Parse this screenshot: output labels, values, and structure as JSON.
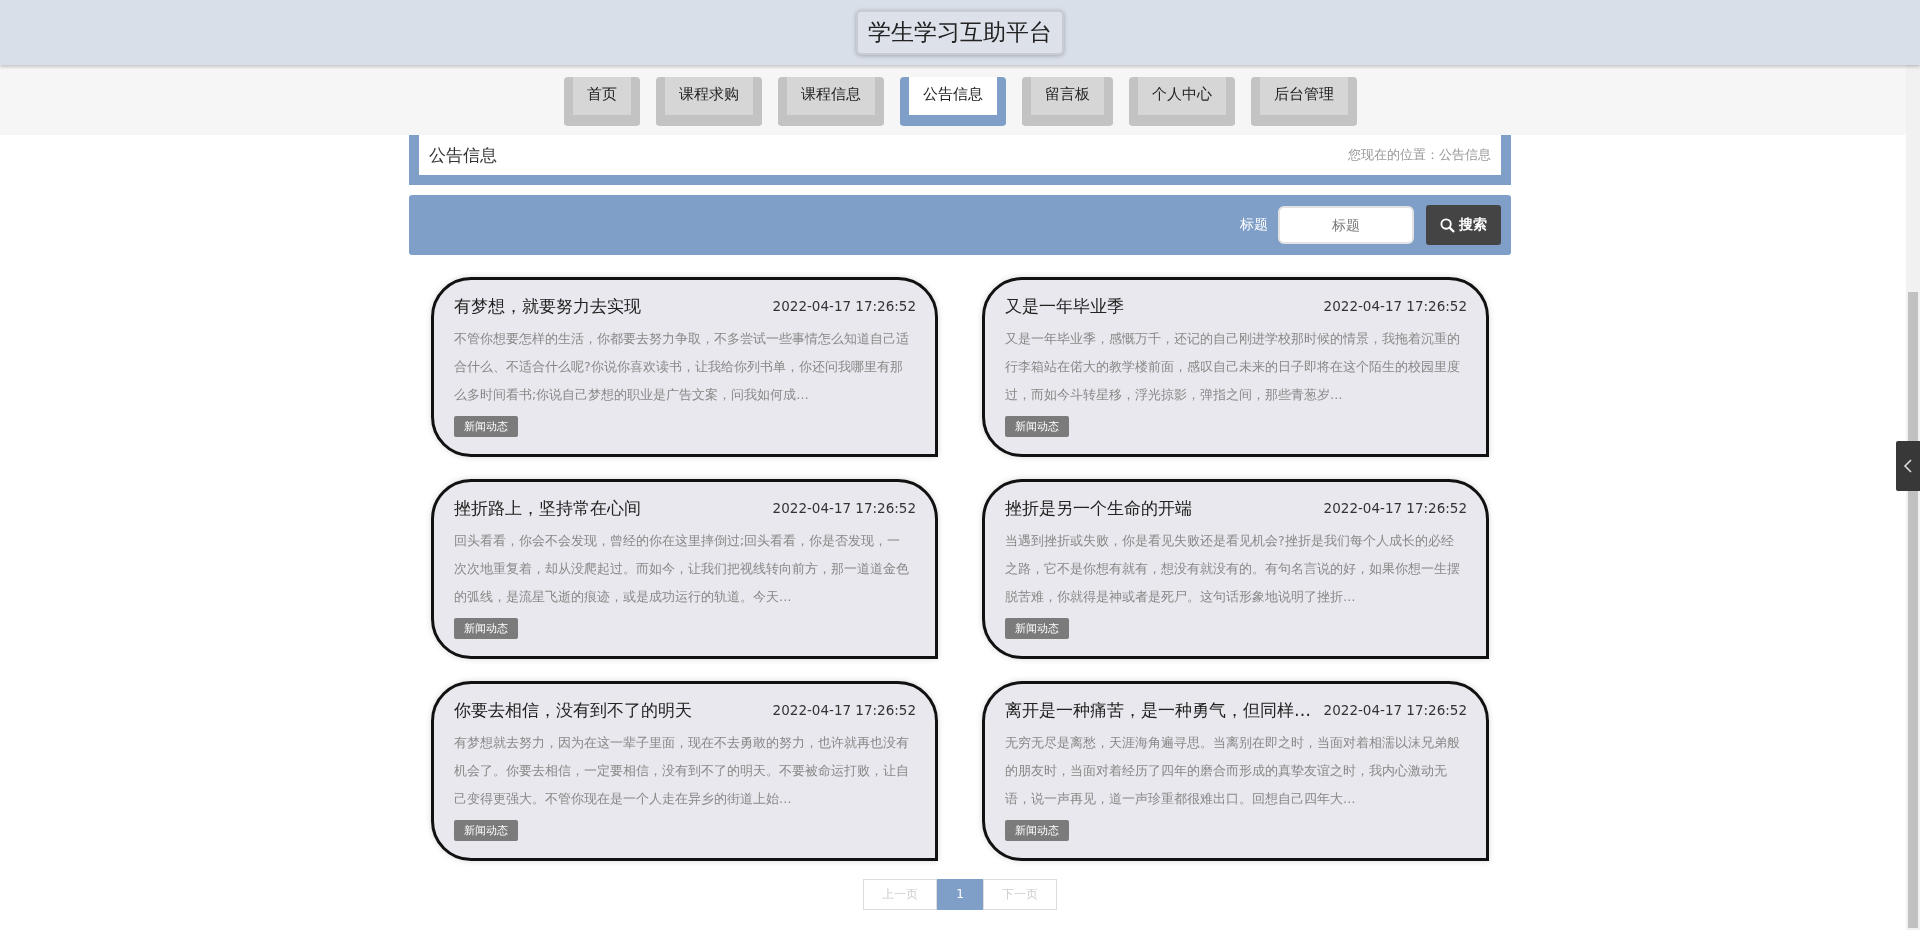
{
  "header": {
    "title": "学生学习互助平台"
  },
  "nav": [
    {
      "label": "首页",
      "selected": false
    },
    {
      "label": "课程求购",
      "selected": false
    },
    {
      "label": "课程信息",
      "selected": false
    },
    {
      "label": "公告信息",
      "selected": true
    },
    {
      "label": "留言板",
      "selected": false
    },
    {
      "label": "个人中心",
      "selected": false
    },
    {
      "label": "后台管理",
      "selected": false
    }
  ],
  "breadcrumb": {
    "heading": "公告信息",
    "location": "您现在的位置：公告信息"
  },
  "search": {
    "label": "标题",
    "placeholder": "标题",
    "button": "搜索"
  },
  "notices": [
    {
      "title": "有梦想，就要努力去实现",
      "date": "2022-04-17 17:26:52",
      "summary": "不管你想要怎样的生活，你都要去努力争取，不多尝试一些事情怎么知道自己适合什么、不适合什么呢?你说你喜欢读书，让我给你列书单，你还问我哪里有那么多时间看书;你说自己梦想的职业是广告文案，问我如何成…",
      "tag": "新闻动态"
    },
    {
      "title": "又是一年毕业季",
      "date": "2022-04-17 17:26:52",
      "summary": "又是一年毕业季，感慨万千，还记的自己刚进学校那时候的情景，我拖着沉重的行李箱站在偌大的教学楼前面，感叹自己未来的日子即将在这个陌生的校园里度过，而如今斗转星移，浮光掠影，弹指之间，那些青葱岁…",
      "tag": "新闻动态"
    },
    {
      "title": "挫折路上，坚持常在心间",
      "date": "2022-04-17 17:26:52",
      "summary": "回头看看，你会不会发现，曾经的你在这里摔倒过;回头看看，你是否发现，一次次地重复着，却从没爬起过。而如今，让我们把视线转向前方，那一道道金色的弧线，是流星飞逝的痕迹，或是成功运行的轨道。今天…",
      "tag": "新闻动态"
    },
    {
      "title": "挫折是另一个生命的开端",
      "date": "2022-04-17 17:26:52",
      "summary": "当遇到挫折或失败，你是看见失败还是看见机会?挫折是我们每个人成长的必经之路，它不是你想有就有，想没有就没有的。有句名言说的好，如果你想一生摆脱苦难，你就得是神或者是死尸。这句话形象地说明了挫折…",
      "tag": "新闻动态"
    },
    {
      "title": "你要去相信，没有到不了的明天",
      "date": "2022-04-17 17:26:52",
      "summary": "有梦想就去努力，因为在这一辈子里面，现在不去勇敢的努力，也许就再也没有机会了。你要去相信，一定要相信，没有到不了的明天。不要被命运打败，让自己变得更强大。不管你现在是一个人走在异乡的街道上始…",
      "tag": "新闻动态"
    },
    {
      "title": "离开是一种痛苦，是一种勇气，但同样…",
      "date": "2022-04-17 17:26:52",
      "summary": "无穷无尽是离愁，天涯海角遍寻思。当离别在即之时，当面对着相濡以沫兄弟般的朋友时，当面对着经历了四年的磨合而形成的真挚友谊之时，我内心激动无语，说一声再见，道一声珍重都很难出口。回想自己四年大…",
      "tag": "新闻动态"
    }
  ],
  "pagination": {
    "prev": "上一页",
    "pages": [
      {
        "label": "1",
        "selected": true
      }
    ],
    "next": "下一页"
  }
}
